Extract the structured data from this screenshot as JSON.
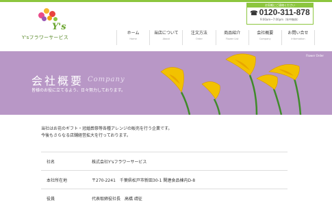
{
  "brand": {
    "logo_text": "Y'sフラワーサービス",
    "logo_ys": "Y's"
  },
  "contact": {
    "header": "お気軽にご連絡ください",
    "phone": "0120-311-878",
    "hours": "9:00am~7:00pm（年中無休）"
  },
  "nav": {
    "items": [
      {
        "label": "ホーム",
        "sub": "Home"
      },
      {
        "label": "当店について",
        "sub": "About"
      },
      {
        "label": "注文方法",
        "sub": "Order"
      },
      {
        "label": "商品紹介",
        "sub": "Flower List"
      },
      {
        "label": "会社概要",
        "sub": "Company"
      },
      {
        "label": "お問い合せ",
        "sub": "Information"
      }
    ]
  },
  "hero": {
    "tag": "Flower Order",
    "title": "会社概要",
    "title_en": "Company",
    "subtitle": "皆様のお役に立てるよう、日々努力しております。",
    "bg_color": "#b897c6"
  },
  "intro": {
    "line1": "当社はお花のギフト・冠婚葬祭等各種アレンジの販売を行う企業です。",
    "line2": "今後もさらなる店舗経営拡大を行っております。"
  },
  "company_info": {
    "rows": [
      {
        "label": "社名",
        "value": "株式会社Y'sフラワーサービス"
      },
      {
        "label": "本社所在地",
        "value": "〒270-2241　千葉県松戸市新田30-1 関連食品棟内D-8"
      },
      {
        "label": "役員",
        "value": "代表取締役社長　高橋 靖征"
      }
    ]
  }
}
